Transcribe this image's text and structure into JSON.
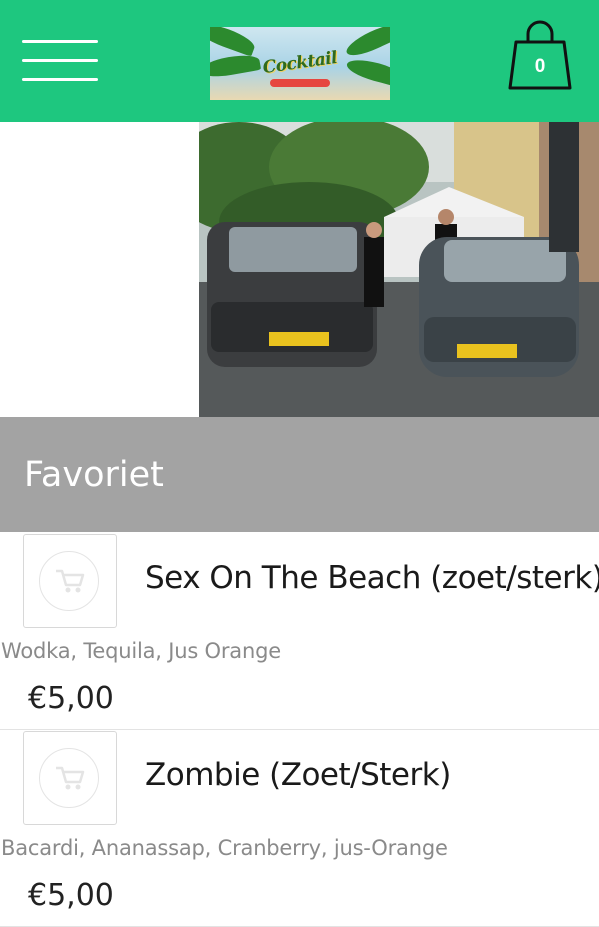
{
  "header": {
    "logo_text": "Cocktail",
    "cart_count": "0",
    "colors": {
      "bar": "#1ec77f"
    }
  },
  "icons": {
    "menu": "hamburger-menu-icon",
    "cart": "shopping-bag-icon",
    "add_to_cart": "cart-icon"
  },
  "section": {
    "title": "Favoriet"
  },
  "products": [
    {
      "name": "Sex On The Beach (zoet/sterk)",
      "description": "Wodka, Tequila, Jus Orange",
      "price": "€5,00"
    },
    {
      "name": "Zombie (Zoet/Sterk)",
      "description": "Bacardi, Ananassap, Cranberry, jus-Orange",
      "price": "€5,00"
    }
  ]
}
